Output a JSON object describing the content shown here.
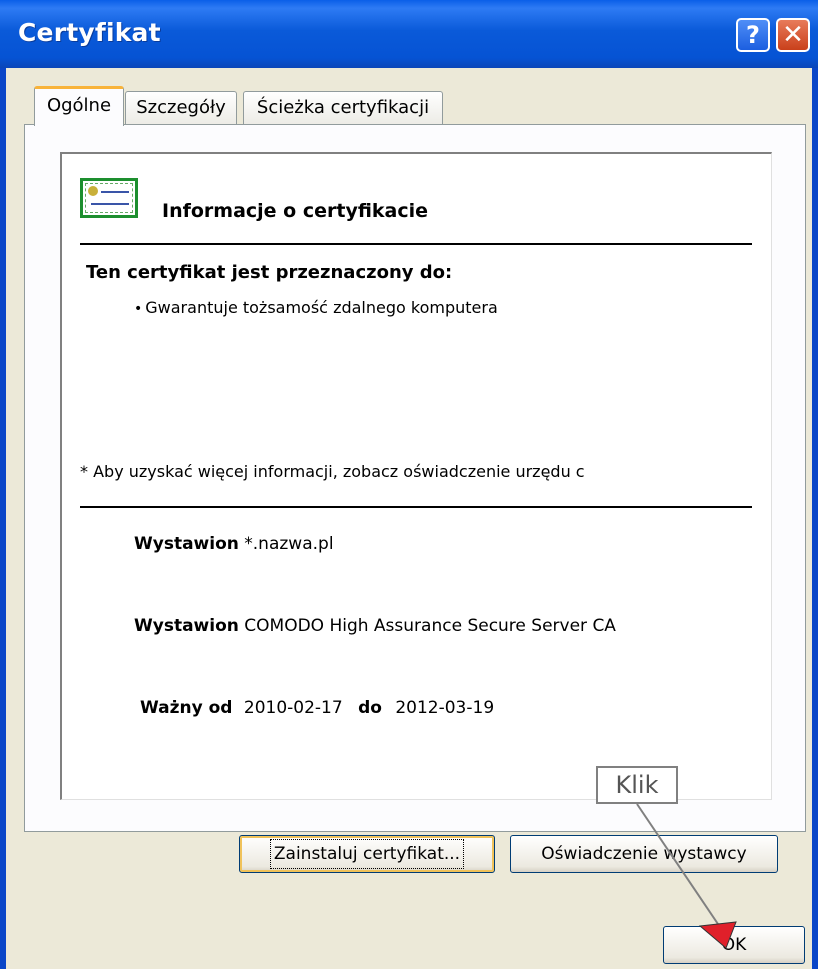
{
  "window": {
    "title": "Certyfikat",
    "help_button": "?",
    "close_button": "✕"
  },
  "tabs": [
    {
      "label": "Ogólne",
      "active": true
    },
    {
      "label": "Szczegóły",
      "active": false
    },
    {
      "label": "Ścieżka certyfikacji",
      "active": false
    }
  ],
  "general": {
    "info_title": "Informacje o certyfikacie",
    "purpose_heading": "Ten certyfikat jest przeznaczony do:",
    "purpose_items": [
      "Gwarantuje tożsamość zdalnego komputera"
    ],
    "note": "* Aby uzyskać więcej informacji, zobacz oświadczenie urzędu c",
    "issued_to_label": "Wystawion",
    "issued_to_value": "*.nazwa.pl",
    "issued_by_label": "Wystawion",
    "issued_by_value": "COMODO High Assurance Secure Server CA",
    "valid_from_label": "Ważny od",
    "valid_from": "2010-02-17",
    "valid_to_label": "do",
    "valid_to": "2012-03-19"
  },
  "buttons": {
    "install": "Zainstaluj certyfikat...",
    "issuer_statement": "Oświadczenie wystawcy",
    "ok": "OK"
  },
  "annotation": {
    "callout": "Klik",
    "arrow_color": "#e0202a"
  },
  "colors": {
    "titlebar": "#0a5ad9",
    "dialog_bg": "#ece9d8",
    "active_tab_accent": "#f8b33a",
    "cert_icon": "#1d8f2f"
  },
  "icons": [
    "cert-icon",
    "help-icon",
    "close-icon"
  ]
}
